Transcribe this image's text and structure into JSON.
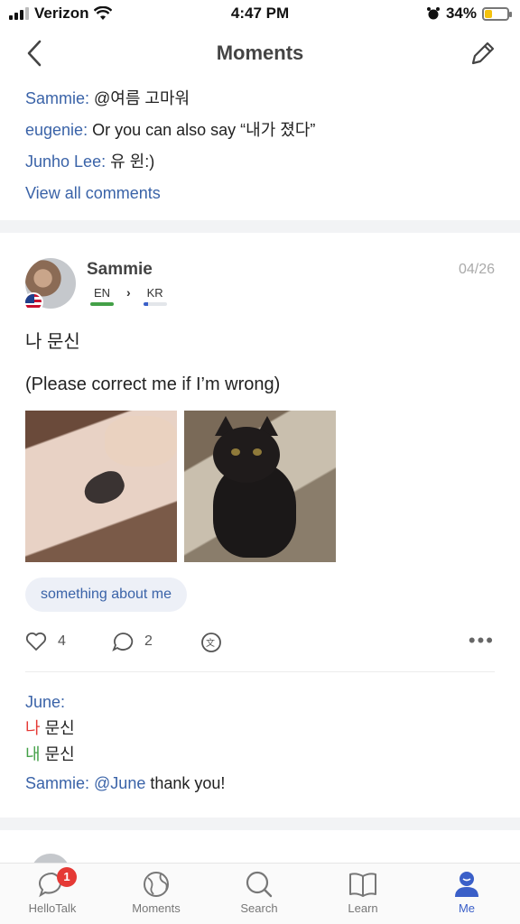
{
  "status_bar": {
    "carrier": "Verizon",
    "time": "4:47 PM",
    "battery": "34%",
    "battery_level": 0.34
  },
  "nav": {
    "title": "Moments"
  },
  "top_comments": [
    {
      "author": "Sammie:",
      "text": "@여름  고마워"
    },
    {
      "author": "eugenie:",
      "text": "Or you can also say “내가 졌다”"
    },
    {
      "author": "Junho Lee:",
      "text": "유 윈:)"
    }
  ],
  "view_all_comments": "View all comments",
  "post": {
    "username": "Sammie",
    "date": "04/26",
    "native_lang": "EN",
    "learning_lang": "KR",
    "native_level": 1.0,
    "learning_level": 0.2,
    "text_line1": "나 문신",
    "text_line2": "(Please correct me if I’m wrong)",
    "tag": "something about me",
    "likes": "4",
    "comments": "2",
    "correction": {
      "author": "June:",
      "wrong_word": "나",
      "wrong_rest": " 문신",
      "right_word": "내",
      "right_rest": " 문신"
    },
    "reply": {
      "author": "Sammie:",
      "mention": "@June",
      "text": " thank you!"
    }
  },
  "tabs": [
    {
      "label": "HelloTalk",
      "badge": "1"
    },
    {
      "label": "Moments"
    },
    {
      "label": "Search"
    },
    {
      "label": "Learn"
    },
    {
      "label": "Me"
    }
  ],
  "colors": {
    "link": "#3a63a8",
    "active_tab": "#3a5fc8",
    "badge": "#e53935"
  }
}
